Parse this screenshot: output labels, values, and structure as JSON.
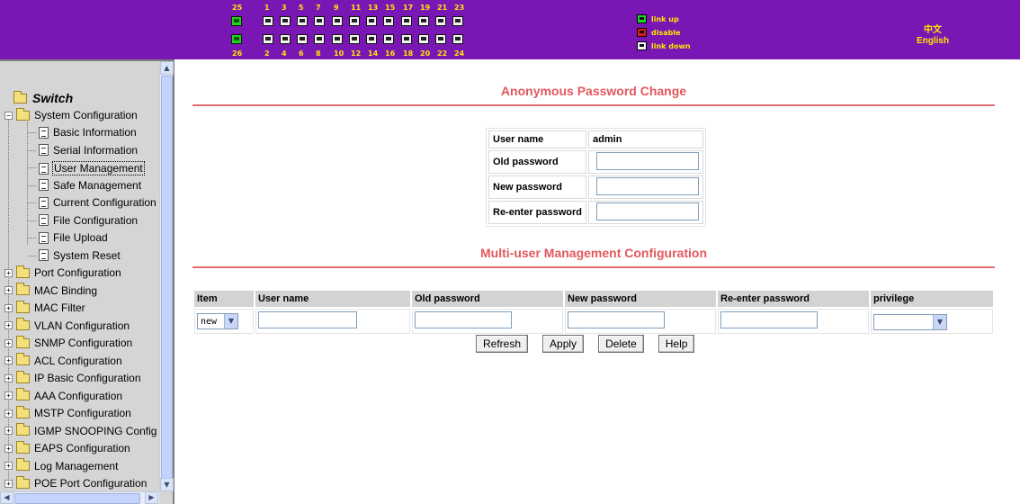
{
  "banner": {
    "ports_top_odd": [
      "1",
      "3",
      "5",
      "7",
      "9",
      "11",
      "13",
      "15",
      "17",
      "19",
      "21",
      "23"
    ],
    "ports_bottom_even": [
      "2",
      "4",
      "6",
      "8",
      "10",
      "12",
      "14",
      "16",
      "18",
      "20",
      "22",
      "24"
    ],
    "uplink_top": "25",
    "uplink_bottom": "26",
    "legend": {
      "link_up": "link up",
      "disable": "disable",
      "link_down": "link down"
    },
    "lang_chinese": "中文",
    "lang_english": "English",
    "colors": {
      "background": "#7a16b4",
      "text": "#ffe800",
      "link_up": "#20d820",
      "disable": "#e01818",
      "link_down": "#f4f4f4"
    }
  },
  "sidebar": {
    "root": "Switch",
    "system_configuration": "System Configuration",
    "system_children": [
      "Basic Information",
      "Serial Information",
      "User Management",
      "Safe Management",
      "Current Configuration",
      "File Configuration",
      "File Upload",
      "System Reset"
    ],
    "selected": "User Management",
    "folders": [
      "Port Configuration",
      "MAC Binding",
      "MAC Filter",
      "VLAN Configuration",
      "SNMP Configuration",
      "ACL Configuration",
      "IP Basic Configuration",
      "AAA Configuration",
      "MSTP Configuration",
      "IGMP SNOOPING Config",
      "EAPS Configuration",
      "Log Management",
      "POE Port Configuration"
    ]
  },
  "main": {
    "anon_title": "Anonymous Password Change",
    "anon_form": {
      "user_name_label": "User name",
      "user_name_value": "admin",
      "old_password_label": "Old password",
      "new_password_label": "New password",
      "reenter_password_label": "Re-enter password",
      "old_password_value": "",
      "new_password_value": "",
      "reenter_password_value": ""
    },
    "multi_title": "Multi-user Management Configuration",
    "multi_table": {
      "headers": [
        "Item",
        "User name",
        "Old password",
        "New password",
        "Re-enter password",
        "privilege"
      ],
      "row": {
        "item_select": "new",
        "user_name": "",
        "old_password": "",
        "new_password": "",
        "reenter_password": "",
        "privilege": ""
      }
    },
    "buttons": {
      "refresh": "Refresh",
      "apply": "Apply",
      "delete": "Delete",
      "help": "Help"
    },
    "accent_color": "#e2585e"
  }
}
